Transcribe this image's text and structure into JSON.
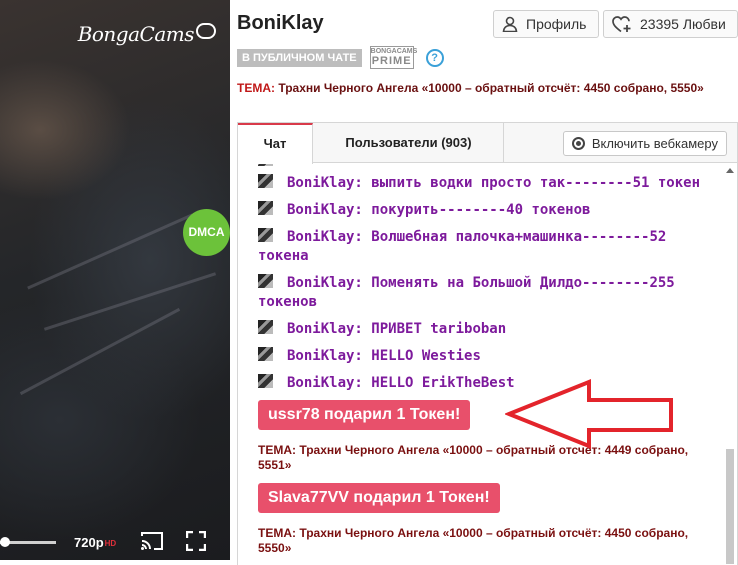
{
  "video": {
    "logo_text": "BongaCams",
    "dmca_label": "DMCA",
    "quality": "720p",
    "quality_badge": "HD"
  },
  "header": {
    "model_name": "BoniKlay",
    "profile_button": "Профиль",
    "love_button": "23395 Любви",
    "status_badge": "В ПУБЛИЧНОМ ЧАТЕ",
    "prime_top": "BONGACAMS",
    "prime_bottom": "PRIME",
    "help_glyph": "?",
    "topic_label": "ТЕМА:",
    "topic_text": "Трахни Черного Ангела «10000 – обратный отсчёт: 4450 собрано, 5550»"
  },
  "tabs": {
    "chat": "Чат",
    "users": "Пользователи (903)",
    "webcam_button": "Включить вебкамеру"
  },
  "messages": [
    {
      "user": "BoniKlay:",
      "text": "выпить водки просто так--------51 токен"
    },
    {
      "user": "BoniKlay:",
      "text": "покурить--------40 токенов"
    },
    {
      "user": "BoniKlay:",
      "text": "Волшебная палочка+машинка--------52 токена"
    },
    {
      "user": "BoniKlay:",
      "text": "Поменять на Большой Дилдо--------255 токенов"
    },
    {
      "user": "BoniKlay:",
      "text": "ПРИВЕТ  tariboban"
    },
    {
      "user": "BoniKlay:",
      "text": "HELLO  Westies"
    },
    {
      "user": "BoniKlay:",
      "text": "HELLO  ErikTheBest"
    }
  ],
  "gift1": "ussr78 подарил 1 Токен!",
  "sys1": "ТЕМА: Трахни Черного Ангела «10000 – обратный отсчёт: 4449 собрано, 5551»",
  "gift2": "Slava77VV подарил 1 Токен!",
  "sys2": "ТЕМА: Трахни Черного Ангела «10000 – обратный отсчёт: 4450 собрано, 5550»",
  "colors": {
    "accent": "#d93a4a",
    "gift_bg": "#e8506b",
    "message_text": "#7d1a9c",
    "annotation_arrow": "#e3242b"
  }
}
